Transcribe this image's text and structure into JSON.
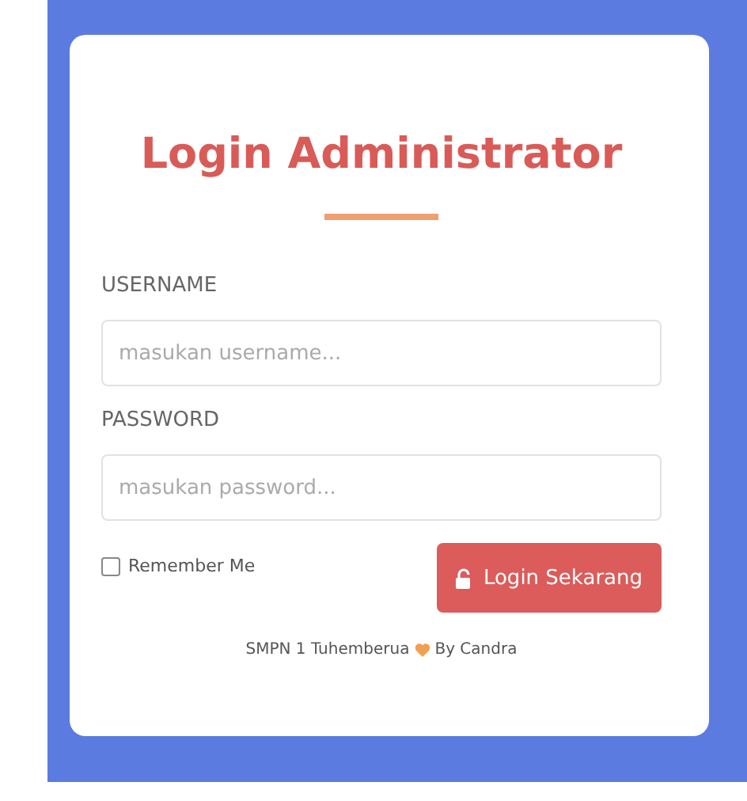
{
  "title": "Login Administrator",
  "fields": [
    {
      "label": "USERNAME",
      "placeholder": "masukan username..."
    },
    {
      "label": "PASSWORD",
      "placeholder": "masukan password..."
    }
  ],
  "remember": {
    "label": "Remember Me",
    "checked": false
  },
  "button": {
    "label": "Login Sekarang"
  },
  "footer": {
    "before": "SMPN 1 Tuhemberua",
    "after": "By Candra"
  }
}
